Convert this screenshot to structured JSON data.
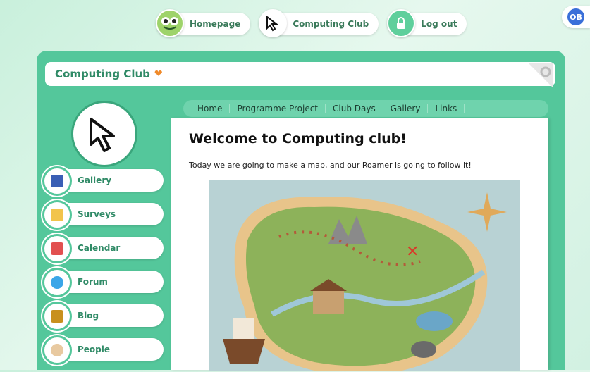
{
  "topnav": {
    "homepage": "Homepage",
    "computing_club": "Computing Club",
    "logout": "Log out"
  },
  "brand": {
    "badge": "OB"
  },
  "panel": {
    "title": "Computing Club",
    "tabs": [
      "Home",
      "Programme Project",
      "Club Days",
      "Gallery",
      "Links"
    ]
  },
  "sidebar": {
    "items": [
      {
        "label": "Gallery",
        "icon": "gallery-icon",
        "color": "#3a5fb5"
      },
      {
        "label": "Surveys",
        "icon": "surveys-icon",
        "color": "#f2c44c"
      },
      {
        "label": "Calendar",
        "icon": "calendar-icon",
        "color": "#e25050"
      },
      {
        "label": "Forum",
        "icon": "forum-icon",
        "color": "#3aa6e8"
      },
      {
        "label": "Blog",
        "icon": "blog-icon",
        "color": "#c8901e"
      },
      {
        "label": "People",
        "icon": "people-icon",
        "color": "#e8c9a0"
      }
    ]
  },
  "content": {
    "heading": "Welcome to Computing club!",
    "intro": "Today we are going to make a map, and our Roamer is going to follow it!"
  },
  "colors": {
    "panel": "#54c79b",
    "accent": "#2f8a66"
  }
}
